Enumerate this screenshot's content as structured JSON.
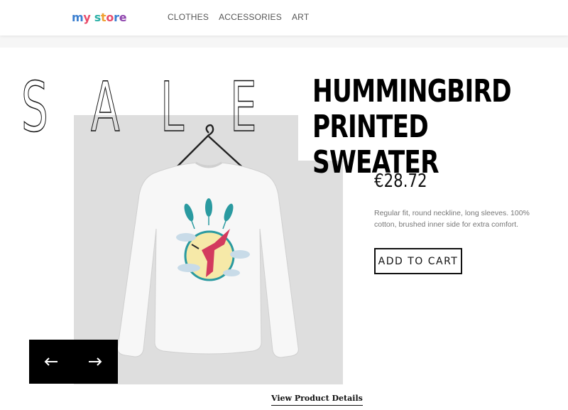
{
  "header": {
    "logo_text": "my store",
    "logo_letters": [
      "m",
      "y",
      " ",
      "s",
      "t",
      "o",
      "r",
      "e"
    ],
    "logo_colors": [
      "#3b7fd0",
      "#e94b6a",
      "#ffffff",
      "#2bb0a7",
      "#f0a030",
      "#e94b6a",
      "#3b7fd0",
      "#8e44ad"
    ],
    "nav": [
      {
        "label": "CLOTHES"
      },
      {
        "label": "ACCESSORIES"
      },
      {
        "label": "ART"
      }
    ]
  },
  "hero": {
    "sale_letters": [
      "S",
      "A",
      "L",
      "E"
    ],
    "product_title": "HUMMINGBIRD PRINTED SWEATER",
    "price": "€28.72",
    "description": "Regular fit, round neckline, long sleeves. 100% cotton, brushed inner side for extra comfort.",
    "add_to_cart": "ADD TO CART",
    "view_details": "View Product Details"
  },
  "icons": {
    "prev": "arrow-left-icon",
    "next": "arrow-right-icon"
  },
  "colors": {
    "photo_bg": "#dedede",
    "dark": "#000000",
    "muted_text": "#777777"
  }
}
